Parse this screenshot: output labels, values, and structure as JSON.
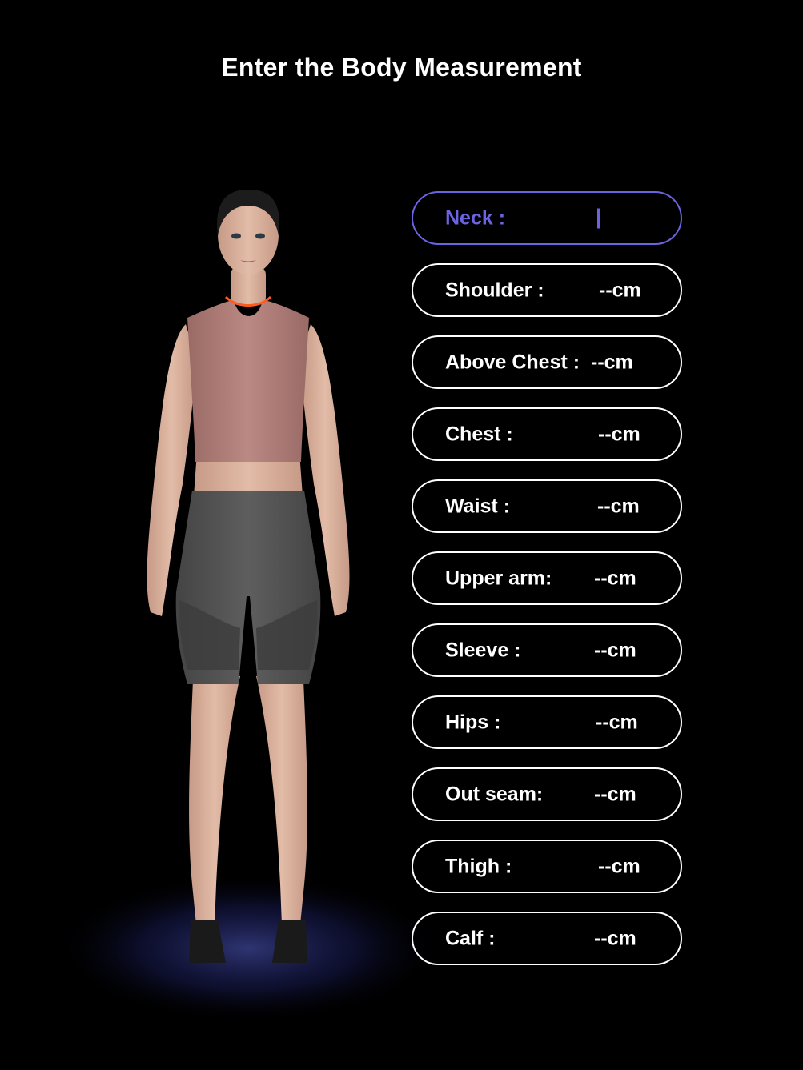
{
  "page": {
    "title": "Enter the Body Measurement"
  },
  "fields": [
    {
      "label": "Neck :",
      "value": "",
      "active": true
    },
    {
      "label": "Shoulder :",
      "value": "--cm"
    },
    {
      "label": "Above Chest :",
      "value": "--cm"
    },
    {
      "label": "Chest :",
      "value": "--cm"
    },
    {
      "label": "Waist :",
      "value": "--cm"
    },
    {
      "label": "Upper arm:",
      "value": "--cm"
    },
    {
      "label": "Sleeve :",
      "value": "--cm"
    },
    {
      "label": "Hips :",
      "value": "--cm"
    },
    {
      "label": "Out seam:",
      "value": "--cm"
    },
    {
      "label": "Thigh :",
      "value": "--cm"
    },
    {
      "label": "Calf :",
      "value": "--cm"
    }
  ],
  "colors": {
    "background": "#000000",
    "accent": "#6b63e0",
    "field_border": "#ffffff",
    "neck_marker": "#ff5a1f",
    "top": "#b07c78",
    "shorts": "#555555",
    "skin": "#d8b09c"
  }
}
